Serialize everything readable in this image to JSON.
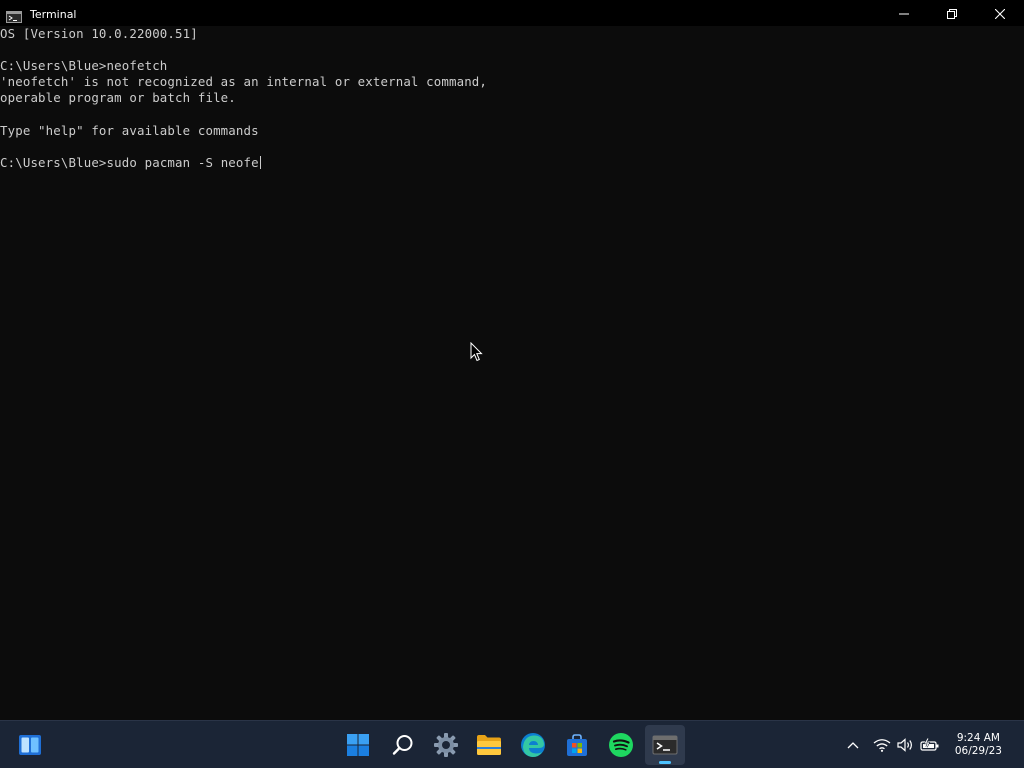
{
  "window": {
    "title": "Terminal",
    "icon": "terminal-icon",
    "controls": [
      "minimize-icon",
      "restore-icon",
      "close-icon"
    ]
  },
  "terminal": {
    "lines": [
      "OS [Version 10.0.22000.51]",
      "",
      "C:\\Users\\Blue>neofetch",
      "'neofetch' is not recognized as an internal or external command,",
      "operable program or batch file.",
      "",
      "Type \"help\" for available commands",
      ""
    ],
    "prompt": "C:\\Users\\Blue>",
    "current_input": "sudo pacman -S neofe"
  },
  "taskbar": {
    "widgets_icon": "widgets-icon",
    "pinned": [
      {
        "name": "start-button",
        "icon": "windows-logo-icon"
      },
      {
        "name": "search-button",
        "icon": "search-icon"
      },
      {
        "name": "settings-button",
        "icon": "gear-icon"
      },
      {
        "name": "file-explorer-button",
        "icon": "folder-icon"
      },
      {
        "name": "edge-button",
        "icon": "edge-icon"
      },
      {
        "name": "store-button",
        "icon": "store-icon"
      },
      {
        "name": "spotify-button",
        "icon": "spotify-icon"
      },
      {
        "name": "terminal-button",
        "icon": "terminal-icon",
        "active": true
      }
    ],
    "tray": [
      "chevron-up-icon",
      "wifi-icon",
      "volume-icon",
      "battery-icon"
    ],
    "clock": {
      "time": "9:24 AM",
      "date": "06/29/23"
    }
  },
  "colors": {
    "terminal_bg": "#0c0c0c",
    "terminal_fg": "#cccccc",
    "titlebar_bg": "#000000",
    "taskbar_bg": "#1b2536",
    "accent": "#4cc2ff"
  }
}
